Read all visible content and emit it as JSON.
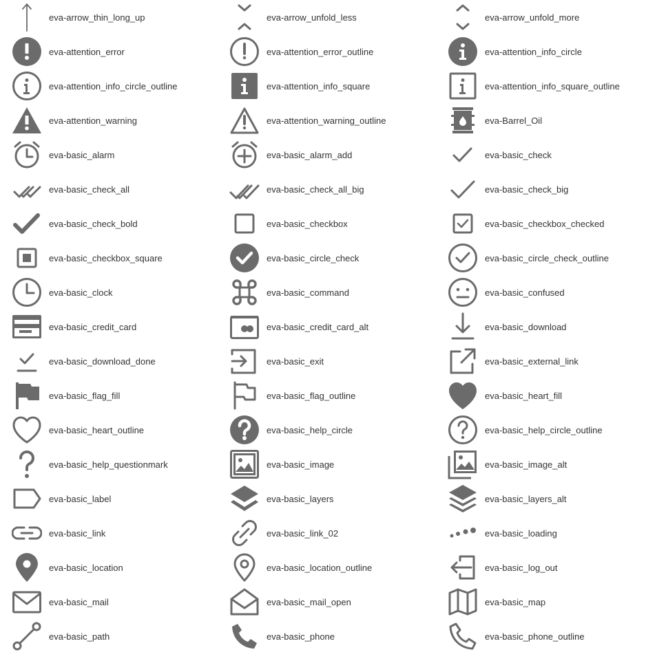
{
  "icon_color": "#6b6b6b",
  "items": [
    {
      "label": "eva-arrow_thin_long_up",
      "icon": "arrow-thin-long-up-icon"
    },
    {
      "label": "eva-arrow_unfold_less",
      "icon": "arrow-unfold-less-icon"
    },
    {
      "label": "eva-arrow_unfold_more",
      "icon": "arrow-unfold-more-icon"
    },
    {
      "label": "eva-attention_error",
      "icon": "attention-error-icon"
    },
    {
      "label": "eva-attention_error_outline",
      "icon": "attention-error-outline-icon"
    },
    {
      "label": "eva-attention_info_circle",
      "icon": "attention-info-circle-icon"
    },
    {
      "label": "eva-attention_info_circle_outline",
      "icon": "attention-info-circle-outline-icon"
    },
    {
      "label": "eva-attention_info_square",
      "icon": "attention-info-square-icon"
    },
    {
      "label": "eva-attention_info_square_outline",
      "icon": "attention-info-square-outline-icon"
    },
    {
      "label": "eva-attention_warning",
      "icon": "attention-warning-icon"
    },
    {
      "label": "eva-attention_warning_outline",
      "icon": "attention-warning-outline-icon"
    },
    {
      "label": "eva-Barrel_Oil",
      "icon": "barrel-oil-icon"
    },
    {
      "label": "eva-basic_alarm",
      "icon": "alarm-icon"
    },
    {
      "label": "eva-basic_alarm_add",
      "icon": "alarm-add-icon"
    },
    {
      "label": "eva-basic_check",
      "icon": "check-icon"
    },
    {
      "label": "eva-basic_check_all",
      "icon": "check-all-icon"
    },
    {
      "label": "eva-basic_check_all_big",
      "icon": "check-all-big-icon"
    },
    {
      "label": "eva-basic_check_big",
      "icon": "check-big-icon"
    },
    {
      "label": "eva-basic_check_bold",
      "icon": "check-bold-icon"
    },
    {
      "label": "eva-basic_checkbox",
      "icon": "checkbox-icon"
    },
    {
      "label": "eva-basic_checkbox_checked",
      "icon": "checkbox-checked-icon"
    },
    {
      "label": "eva-basic_checkbox_square",
      "icon": "checkbox-square-icon"
    },
    {
      "label": "eva-basic_circle_check",
      "icon": "circle-check-icon"
    },
    {
      "label": "eva-basic_circle_check_outline",
      "icon": "circle-check-outline-icon"
    },
    {
      "label": "eva-basic_clock",
      "icon": "clock-icon"
    },
    {
      "label": "eva-basic_command",
      "icon": "command-icon"
    },
    {
      "label": "eva-basic_confused",
      "icon": "confused-icon"
    },
    {
      "label": "eva-basic_credit_card",
      "icon": "credit-card-icon"
    },
    {
      "label": "eva-basic_credit_card_alt",
      "icon": "credit-card-alt-icon"
    },
    {
      "label": "eva-basic_download",
      "icon": "download-icon"
    },
    {
      "label": "eva-basic_download_done",
      "icon": "download-done-icon"
    },
    {
      "label": "eva-basic_exit",
      "icon": "exit-icon"
    },
    {
      "label": "eva-basic_external_link",
      "icon": "external-link-icon"
    },
    {
      "label": "eva-basic_flag_fill",
      "icon": "flag-fill-icon"
    },
    {
      "label": "eva-basic_flag_outline",
      "icon": "flag-outline-icon"
    },
    {
      "label": "eva-basic_heart_fill",
      "icon": "heart-fill-icon"
    },
    {
      "label": "eva-basic_heart_outline",
      "icon": "heart-outline-icon"
    },
    {
      "label": "eva-basic_help_circle",
      "icon": "help-circle-icon"
    },
    {
      "label": "eva-basic_help_circle_outline",
      "icon": "help-circle-outline-icon"
    },
    {
      "label": "eva-basic_help_questionmark",
      "icon": "help-questionmark-icon"
    },
    {
      "label": "eva-basic_image",
      "icon": "image-icon"
    },
    {
      "label": "eva-basic_image_alt",
      "icon": "image-alt-icon"
    },
    {
      "label": "eva-basic_label",
      "icon": "label-icon"
    },
    {
      "label": "eva-basic_layers",
      "icon": "layers-icon"
    },
    {
      "label": "eva-basic_layers_alt",
      "icon": "layers-alt-icon"
    },
    {
      "label": "eva-basic_link",
      "icon": "link-icon"
    },
    {
      "label": "eva-basic_link_02",
      "icon": "link-02-icon"
    },
    {
      "label": "eva-basic_loading",
      "icon": "loading-icon"
    },
    {
      "label": "eva-basic_location",
      "icon": "location-icon"
    },
    {
      "label": "eva-basic_location_outline",
      "icon": "location-outline-icon"
    },
    {
      "label": "eva-basic_log_out",
      "icon": "log-out-icon"
    },
    {
      "label": "eva-basic_mail",
      "icon": "mail-icon"
    },
    {
      "label": "eva-basic_mail_open",
      "icon": "mail-open-icon"
    },
    {
      "label": "eva-basic_map",
      "icon": "map-icon"
    },
    {
      "label": "eva-basic_path",
      "icon": "path-icon"
    },
    {
      "label": "eva-basic_phone",
      "icon": "phone-icon"
    },
    {
      "label": "eva-basic_phone_outline",
      "icon": "phone-outline-icon"
    }
  ]
}
